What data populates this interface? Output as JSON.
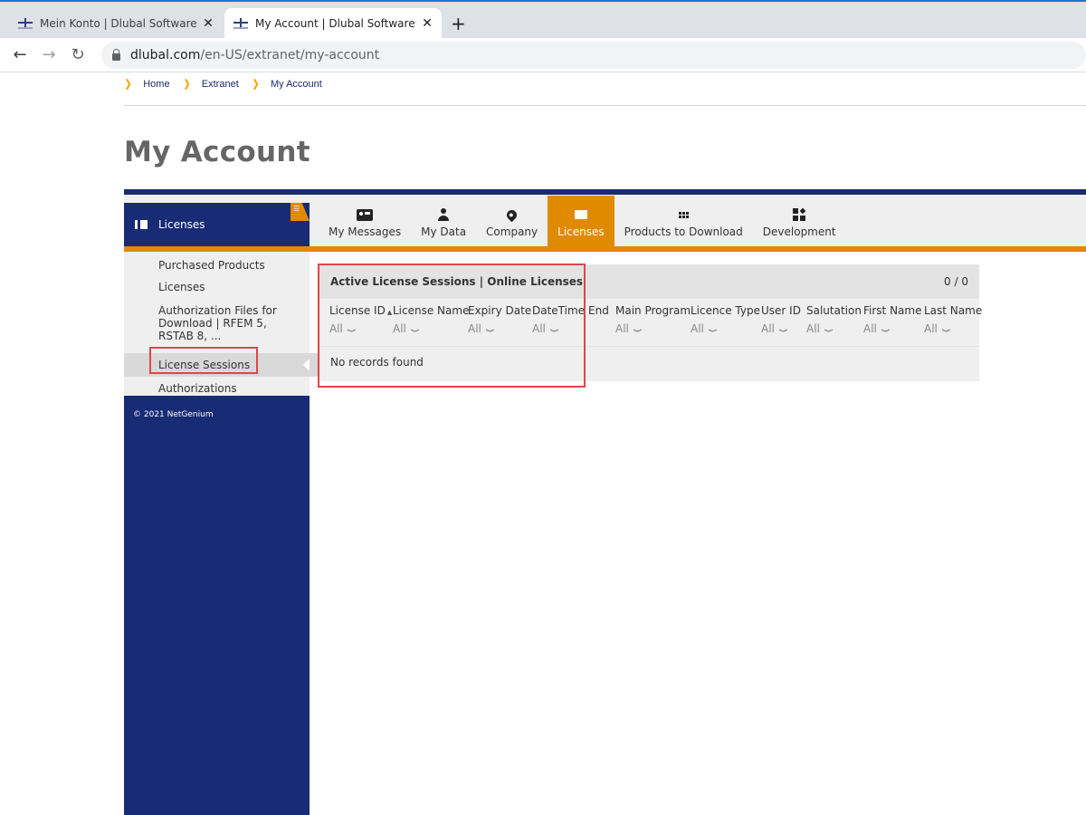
{
  "browser": {
    "tabs": [
      {
        "title": "Mein Konto | Dlubal Software",
        "active": false
      },
      {
        "title": "My Account | Dlubal Software",
        "active": true
      }
    ],
    "new_tab_label": "+",
    "close_label": "✕",
    "url_host": "dlubal.com",
    "url_path": "/en-US/extranet/my-account",
    "nav": {
      "back": "←",
      "forward": "→",
      "reload": "↻"
    }
  },
  "breadcrumb": [
    "Home",
    "Extranet",
    "My Account"
  ],
  "page": {
    "title": "My Account"
  },
  "section": {
    "label": "Licenses"
  },
  "main_tabs": [
    {
      "label": "My Messages",
      "icon": "message-card-icon",
      "active": false
    },
    {
      "label": "My Data",
      "icon": "user-icon",
      "active": false
    },
    {
      "label": "Company",
      "icon": "map-pin-icon",
      "active": false
    },
    {
      "label": "Licenses",
      "icon": "license-icon",
      "active": true
    },
    {
      "label": "Products to Download",
      "icon": "grid-icon",
      "active": false
    },
    {
      "label": "Development",
      "icon": "development-icon",
      "active": false
    }
  ],
  "sidebar": {
    "items": [
      {
        "label": "Purchased Products",
        "active": false
      },
      {
        "label": "Licenses",
        "active": false
      },
      {
        "label": "Authorization Files for Download | RFEM 5, RSTAB 8, ...",
        "active": false
      },
      {
        "label": "License Sessions",
        "active": true
      },
      {
        "label": "Authorizations",
        "active": false
      }
    ],
    "copyright": "© 2021 NetGenium"
  },
  "grid": {
    "title": "Active License Sessions | Online Licenses",
    "pager": "0 / 0",
    "filter_default": "All",
    "columns": [
      {
        "label": "License ID",
        "sorted": "asc",
        "filter": true
      },
      {
        "label": "License Name",
        "filter": true
      },
      {
        "label": "Expiry Date",
        "filter": true
      },
      {
        "label": "DateTime",
        "filter": true
      },
      {
        "label": "End",
        "filter": false
      },
      {
        "label": "Main Program",
        "filter": true
      },
      {
        "label": "Licence Type",
        "filter": true
      },
      {
        "label": "User ID",
        "filter": true
      },
      {
        "label": "Salutation",
        "filter": true
      },
      {
        "label": "First Name",
        "filter": true
      },
      {
        "label": "Last Name",
        "filter": true
      }
    ],
    "empty_message": "No records found"
  },
  "colors": {
    "navy": "#182b75",
    "orange": "#e08a00",
    "highlight": "#e0454a"
  }
}
